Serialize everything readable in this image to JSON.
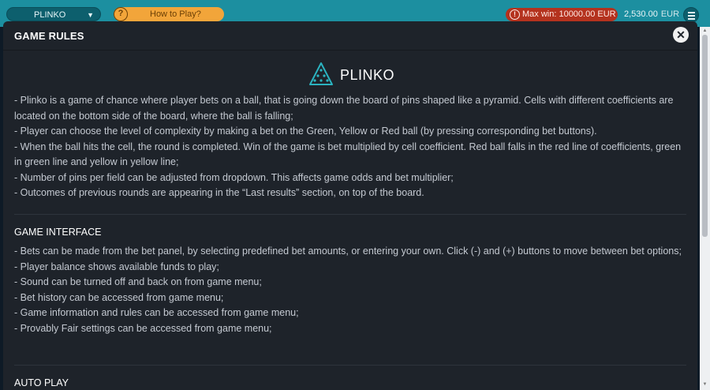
{
  "topbar": {
    "game_select": "PLINKO",
    "how_to_play": "How to Play?",
    "max_win": "Max win: 10000.00 EUR",
    "balance_amount": "2,530.00",
    "balance_currency": "EUR"
  },
  "modal": {
    "title": "GAME RULES",
    "brand_name": "PLINKO",
    "rules": [
      "- Plinko is a game of chance where player bets on a ball, that is going down the board of pins shaped like a pyramid. Cells with different coefficients are located on the bottom side of the board, where the ball is falling;",
      "- Player can choose the level of complexity by making a bet on the Green, Yellow or Red ball (by pressing corresponding bet buttons).",
      "- When the ball hits the cell, the round is completed. Win of the game is bet multiplied by cell coefficient. Red ball falls in the red line of coefficients, green in green line and yellow in yellow line;",
      "- Number of pins per field can be adjusted from dropdown. This affects game odds and bet multiplier;",
      "- Outcomes of previous rounds are appearing in the “Last results” section, on top of the board."
    ],
    "interface_heading": "GAME INTERFACE",
    "interface": [
      "- Bets can be made from the bet panel, by selecting predefined bet amounts, or entering your own. Click (-) and (+) buttons to move between bet options;",
      "- Player balance shows available funds to play;",
      "- Sound can be turned off and back on from game menu;",
      "- Bet history can be accessed from game menu;",
      "- Game information and rules can be accessed from game menu;",
      "- Provably Fair settings can be accessed from game menu;"
    ],
    "autoplay_heading": "AUTO PLAY"
  },
  "colors": {
    "topbar": "#1c8fa0",
    "modal_bg": "#1e232a",
    "max_win_bg": "#b4321e",
    "how_to_play_bg": "#f2a53a",
    "brand_accent": "#2bb3c0"
  },
  "icons": {
    "select_chevron": "chevron-down-icon",
    "how_to_play": "question-icon",
    "max_win": "alert-icon",
    "menu": "hamburger-icon",
    "close": "close-icon",
    "brand": "plinko-pyramid-icon"
  }
}
